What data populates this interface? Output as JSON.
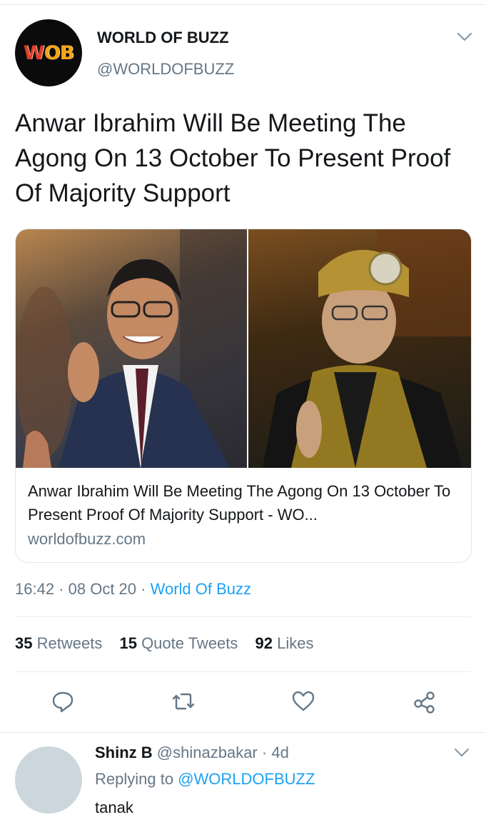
{
  "tweet": {
    "author_name": "WORLD OF BUZZ",
    "author_handle": "@WORLDOFBUZZ",
    "avatar_text": "WOB",
    "text": "Anwar Ibrahim Will Be Meeting The Agong On 13 October To Present Proof Of Majority Support",
    "card": {
      "title": "Anwar Ibrahim Will Be Meeting The Agong On 13 October To Present Proof Of Majority Support - WO...",
      "domain": "worldofbuzz.com"
    },
    "time": "16:42",
    "date": "08 Oct 20",
    "source": "World Of Buzz",
    "stats": [
      {
        "count": "35",
        "label": "Retweets"
      },
      {
        "count": "15",
        "label": "Quote Tweets"
      },
      {
        "count": "92",
        "label": "Likes"
      }
    ],
    "actions": [
      "reply-icon",
      "retweet-icon",
      "like-icon",
      "share-icon"
    ]
  },
  "reply": {
    "name": "Shinz B",
    "handle": "@shinazbakar",
    "age": "4d",
    "replying_label": "Replying to",
    "replying_to": "@WORLDOFBUZZ",
    "text": "tanak"
  },
  "colors": {
    "link": "#1da1f2",
    "secondary_text": "#657786",
    "primary_text": "#14171a",
    "border": "#e6ecf0",
    "wob_orange": "#f2a41a",
    "wob_red": "#e23a2b"
  }
}
